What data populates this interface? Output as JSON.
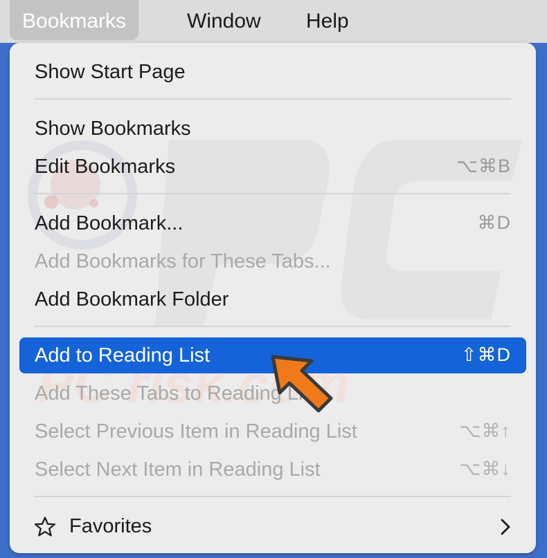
{
  "menubar": {
    "items": [
      {
        "label": "Bookmarks",
        "active": true
      },
      {
        "label": "Window",
        "active": false
      },
      {
        "label": "Help",
        "active": false
      }
    ]
  },
  "menu": {
    "items": [
      {
        "label": "Show Start Page",
        "shortcut": "",
        "enabled": true
      },
      {
        "label": "Show Bookmarks",
        "shortcut": "",
        "enabled": true
      },
      {
        "label": "Edit Bookmarks",
        "shortcut": "⌥⌘B",
        "enabled": true
      },
      {
        "label": "Add Bookmark...",
        "shortcut": "⌘D",
        "enabled": true
      },
      {
        "label": "Add Bookmarks for These Tabs...",
        "shortcut": "",
        "enabled": false
      },
      {
        "label": "Add Bookmark Folder",
        "shortcut": "",
        "enabled": true
      },
      {
        "label": "Add to Reading List",
        "shortcut": "⇧⌘D",
        "enabled": true,
        "highlighted": true
      },
      {
        "label": "Add These Tabs to Reading List",
        "shortcut": "",
        "enabled": false
      },
      {
        "label": "Select Previous Item in Reading List",
        "shortcut": "⌥⌘↑",
        "enabled": false
      },
      {
        "label": "Select Next Item in Reading List",
        "shortcut": "⌥⌘↓",
        "enabled": false
      },
      {
        "label": "Favorites",
        "shortcut": "",
        "enabled": true,
        "submenu": true,
        "icon": "star-icon"
      }
    ]
  },
  "colors": {
    "highlight": "#1463d8",
    "menubar_active": "#c3c3c3",
    "background": "#3d6fc9",
    "pointer_arrow": "#f07a1a"
  },
  "watermark": {
    "text": "PC risk.com"
  }
}
